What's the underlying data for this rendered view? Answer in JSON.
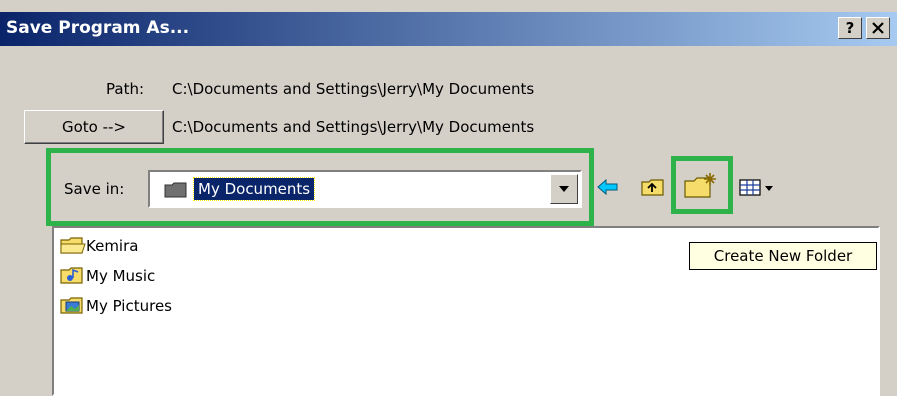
{
  "window": {
    "title": "Save Program As...",
    "help_label": "?",
    "close_label": "✕"
  },
  "path": {
    "label": "Path:",
    "value": "C:\\Documents and Settings\\Jerry\\My Documents"
  },
  "goto": {
    "button_label": "Goto -->",
    "value": "C:\\Documents and Settings\\Jerry\\My Documents"
  },
  "save_in": {
    "label": "Save in:",
    "selected": "My Documents"
  },
  "toolbar": {
    "back_icon": "back-arrow-icon",
    "up_icon": "up-folder-icon",
    "new_folder_icon": "new-folder-icon",
    "view_icon": "view-menu-icon"
  },
  "files": [
    {
      "name": "Kemira",
      "icon": "folder-icon"
    },
    {
      "name": "My Music",
      "icon": "music-folder-icon"
    },
    {
      "name": "My Pictures",
      "icon": "pictures-folder-icon"
    }
  ],
  "tooltip": {
    "text": "Create New Folder"
  },
  "colors": {
    "titlebar_start": "#0a246a",
    "titlebar_end": "#a6caf0",
    "highlight": "#2db34a",
    "selection": "#0a246a",
    "tooltip_bg": "#ffffe1"
  }
}
